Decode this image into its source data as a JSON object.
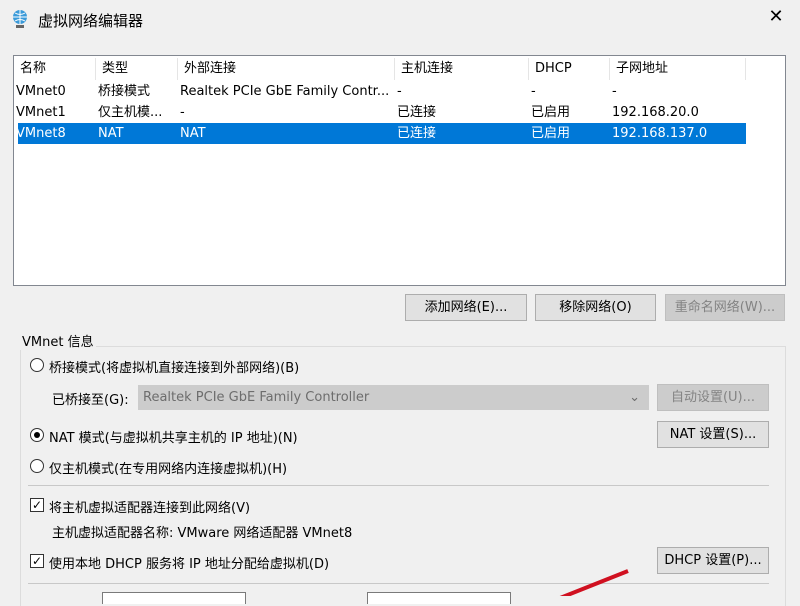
{
  "window": {
    "title": "虚拟网络编辑器",
    "close": "✕"
  },
  "table": {
    "headers": [
      "名称",
      "类型",
      "外部连接",
      "主机连接",
      "DHCP",
      "子网地址"
    ],
    "rows": [
      [
        "VMnet0",
        "桥接模式",
        "Realtek PCIe GbE Family Contr...",
        "-",
        "-",
        "-"
      ],
      [
        "VMnet1",
        "仅主机模...",
        "-",
        "已连接",
        "已启用",
        "192.168.20.0"
      ],
      [
        "VMnet8",
        "NAT",
        "NAT",
        "已连接",
        "已启用",
        "192.168.137.0"
      ]
    ],
    "selected_row": 2
  },
  "buttons": {
    "add": "添加网络(E)...",
    "remove": "移除网络(O)",
    "rename": "重命名网络(W)..."
  },
  "info": {
    "group_label": "VMnet 信息",
    "bridged_label": "桥接模式(将虚拟机直接连接到外部网络)(B)",
    "bridged_to_label": "已桥接至(G):",
    "bridged_to_value": "Realtek PCIe GbE Family Controller",
    "auto_button": "自动设置(U)...",
    "nat_label": "NAT 模式(与虚拟机共享主机的 IP 地址)(N)",
    "nat_button": "NAT 设置(S)...",
    "hostonly_label": "仅主机模式(在专用网络内连接虚拟机)(H)",
    "connect_adapter_label": "将主机虚拟适配器连接到此网络(V)",
    "adapter_name": "主机虚拟适配器名称: VMware 网络适配器 VMnet8",
    "dhcp_label": "使用本地 DHCP 服务将 IP 地址分配给虚拟机(D)",
    "dhcp_button": "DHCP 设置(P)...",
    "mode": "nat",
    "connect_adapter": true,
    "use_dhcp": true
  },
  "colors": {
    "selection": "#0078d7",
    "annotation": "#d01020"
  }
}
